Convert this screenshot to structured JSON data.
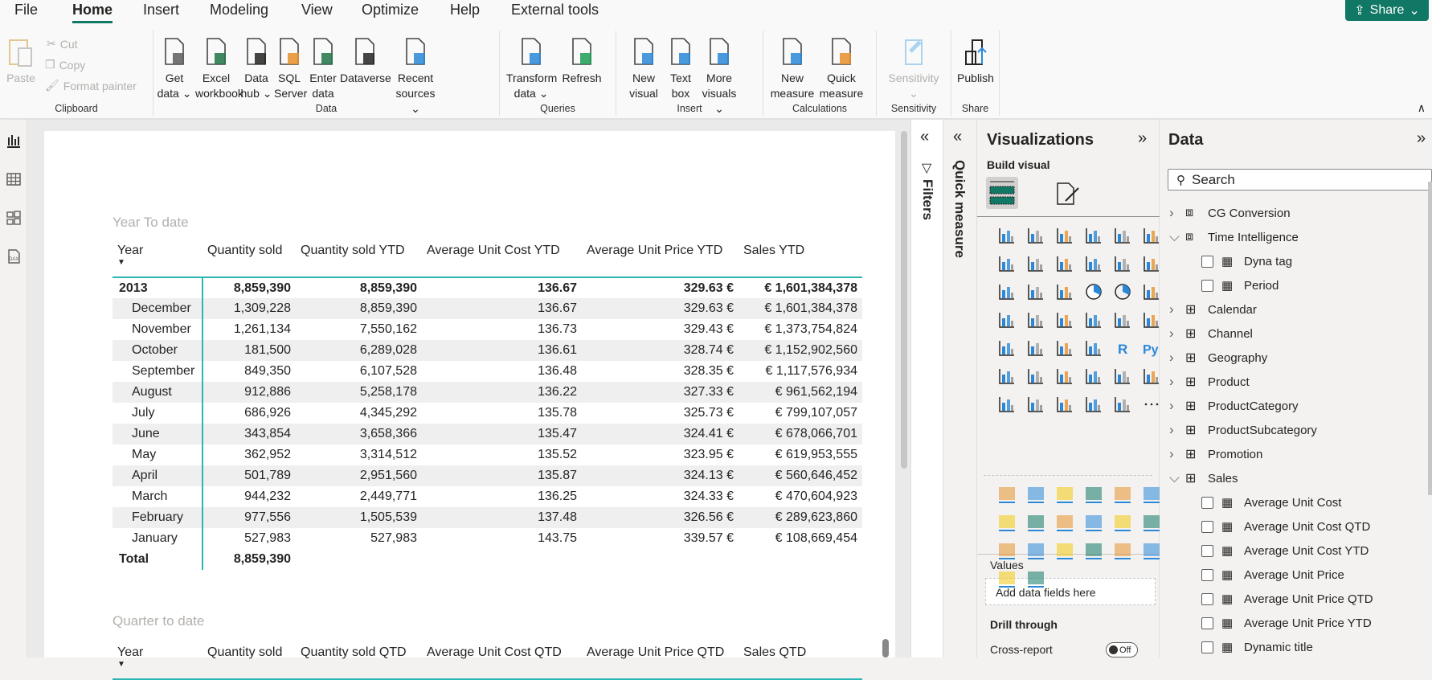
{
  "menu": {
    "tabs": [
      "File",
      "Home",
      "Insert",
      "Modeling",
      "View",
      "Optimize",
      "Help",
      "External tools"
    ],
    "active": "Home",
    "share_label": "Share"
  },
  "ribbon": {
    "clipboard": {
      "label": "Clipboard",
      "paste": "Paste",
      "cut": "Cut",
      "copy": "Copy",
      "format_painter": "Format painter"
    },
    "data": {
      "label": "Data",
      "buttons": [
        {
          "l1": "Get",
          "l2": "data ⌄",
          "icon": "database-icon",
          "accent": "#605e5c"
        },
        {
          "l1": "Excel",
          "l2": "workbook",
          "icon": "excel-icon",
          "accent": "#217346"
        },
        {
          "l1": "Data",
          "l2": "hub ⌄",
          "icon": "data-hub-icon",
          "accent": "#252423"
        },
        {
          "l1": "SQL",
          "l2": "Server",
          "icon": "sql-server-icon",
          "accent": "#e8912d"
        },
        {
          "l1": "Enter",
          "l2": "data",
          "icon": "enter-data-icon",
          "accent": "#217346"
        },
        {
          "l1": "Dataverse",
          "l2": "",
          "icon": "dataverse-icon",
          "accent": "#252423"
        },
        {
          "l1": "Recent",
          "l2": "sources ⌄",
          "icon": "recent-sources-icon",
          "accent": "#2b88d8"
        }
      ]
    },
    "queries": {
      "label": "Queries",
      "buttons": [
        {
          "l1": "Transform",
          "l2": "data ⌄",
          "icon": "transform-data-icon",
          "accent": "#2b88d8"
        },
        {
          "l1": "Refresh",
          "l2": "",
          "icon": "refresh-icon",
          "accent": "#1f9d55"
        }
      ]
    },
    "insert": {
      "label": "Insert",
      "buttons": [
        {
          "l1": "New",
          "l2": "visual",
          "icon": "new-visual-icon",
          "accent": "#2b88d8"
        },
        {
          "l1": "Text",
          "l2": "box",
          "icon": "text-box-icon",
          "accent": "#2b88d8"
        },
        {
          "l1": "More",
          "l2": "visuals ⌄",
          "icon": "more-visuals-icon",
          "accent": "#2b88d8"
        }
      ]
    },
    "calculations": {
      "label": "Calculations",
      "buttons": [
        {
          "l1": "New",
          "l2": "measure",
          "icon": "new-measure-icon",
          "accent": "#2b88d8"
        },
        {
          "l1": "Quick",
          "l2": "measure",
          "icon": "quick-measure-icon",
          "accent": "#e8912d"
        }
      ]
    },
    "sensitivity": {
      "label": "Sensitivity",
      "button": "Sensitivity",
      "chev": "⌄"
    },
    "share": {
      "label": "Share",
      "button": "Publish"
    }
  },
  "report": {
    "ytd": {
      "title": "Year To date",
      "columns": [
        "Year",
        "Quantity sold",
        "Quantity sold YTD",
        "Average Unit Cost YTD",
        "Average Unit Price YTD",
        "Sales YTD"
      ],
      "rows": [
        {
          "type": "year",
          "cells": [
            "2013",
            "8,859,390",
            "8,859,390",
            "136.67",
            "329.63 €",
            "€ 1,601,384,378"
          ]
        },
        {
          "type": "month",
          "cells": [
            "December",
            "1,309,228",
            "8,859,390",
            "136.67",
            "329.63 €",
            "€ 1,601,384,378"
          ]
        },
        {
          "type": "month",
          "cells": [
            "November",
            "1,261,134",
            "7,550,162",
            "136.73",
            "329.43 €",
            "€ 1,373,754,824"
          ]
        },
        {
          "type": "month",
          "cells": [
            "October",
            "181,500",
            "6,289,028",
            "136.61",
            "328.74 €",
            "€ 1,152,902,560"
          ]
        },
        {
          "type": "month",
          "cells": [
            "September",
            "849,350",
            "6,107,528",
            "136.48",
            "328.35 €",
            "€ 1,117,576,934"
          ]
        },
        {
          "type": "month",
          "cells": [
            "August",
            "912,886",
            "5,258,178",
            "136.22",
            "327.33 €",
            "€ 961,562,194"
          ]
        },
        {
          "type": "month",
          "cells": [
            "July",
            "686,926",
            "4,345,292",
            "135.78",
            "325.73 €",
            "€ 799,107,057"
          ]
        },
        {
          "type": "month",
          "cells": [
            "June",
            "343,854",
            "3,658,366",
            "135.47",
            "324.41 €",
            "€ 678,066,701"
          ]
        },
        {
          "type": "month",
          "cells": [
            "May",
            "362,952",
            "3,314,512",
            "135.52",
            "323.95 €",
            "€ 619,953,555"
          ]
        },
        {
          "type": "month",
          "cells": [
            "April",
            "501,789",
            "2,951,560",
            "135.87",
            "324.13 €",
            "€ 560,646,452"
          ]
        },
        {
          "type": "month",
          "cells": [
            "March",
            "944,232",
            "2,449,771",
            "136.25",
            "324.33 €",
            "€ 470,604,923"
          ]
        },
        {
          "type": "month",
          "cells": [
            "February",
            "977,556",
            "1,505,539",
            "137.48",
            "326.56 €",
            "€ 289,623,860"
          ]
        },
        {
          "type": "month",
          "cells": [
            "January",
            "527,983",
            "527,983",
            "143.75",
            "339.57 €",
            "€ 108,669,454"
          ]
        },
        {
          "type": "total",
          "cells": [
            "Total",
            "8,859,390",
            "",
            "",
            "",
            ""
          ]
        }
      ]
    },
    "qtd": {
      "title": "Quarter to date",
      "columns": [
        "Year",
        "Quantity sold",
        "Quantity sold QTD",
        "Average Unit Cost QTD",
        "Average Unit Price QTD",
        "Sales QTD"
      ]
    }
  },
  "filters": {
    "label": "Filters"
  },
  "quick_measure": {
    "label": "Quick measure"
  },
  "visualizations": {
    "title": "Visualizations",
    "build_visual": "Build visual",
    "icons": [
      "stacked-bar-icon",
      "stacked-column-icon",
      "clustered-bar-icon",
      "clustered-column-icon",
      "100-stacked-bar-icon",
      "100-stacked-column-icon",
      "line-chart-icon",
      "area-chart-icon",
      "stacked-area-icon",
      "line-column-icon",
      "line-clustered-column-icon",
      "ribbon-chart-icon",
      "waterfall-icon",
      "funnel-icon",
      "scatter-icon",
      "pie-icon",
      "donut-icon",
      "treemap-icon",
      "map-icon",
      "filled-map-icon",
      "azure-map-icon",
      "gauge-icon",
      "card-icon",
      "multi-row-card-icon",
      "kpi-icon",
      "slicer-icon",
      "table-icon",
      "matrix-icon",
      "r-visual-icon",
      "python-visual-icon",
      "key-influencers-icon",
      "decomposition-tree-icon",
      "qna-icon",
      "smart-narrative-icon",
      "metrics-icon",
      "paginated-report-icon",
      "new-card-icon",
      "new-slicer-icon",
      "arcgis-icon",
      "power-apps-icon",
      "power-automate-icon",
      "more-options-icon"
    ],
    "custom_icons": [
      "custom-gauge-icon",
      "custom-sunburst-icon",
      "custom-bullet-icon",
      "custom-funnel-icon",
      "custom-bar-icon",
      "custom-sparkline-icon",
      "custom-heatmap-icon",
      "custom-cards-icon",
      "custom-small-multiples-icon",
      "custom-gantt-icon",
      "custom-histogram-icon",
      "custom-mekko-icon",
      "custom-bubble-icon",
      "custom-sankey-icon",
      "custom-radar-icon",
      "custom-packed-bubble-icon",
      "custom-timeline-icon",
      "custom-variance-icon",
      "custom-word-cloud-icon",
      "custom-table-icon"
    ],
    "values_label": "Values",
    "values_placeholder": "Add data fields here",
    "drill_through": "Drill through",
    "cross_report": "Cross-report",
    "cross_report_state": "Off"
  },
  "data_pane": {
    "title": "Data",
    "search_placeholder": "Search",
    "items": [
      {
        "label": "CG Conversion",
        "kind": "calc-group",
        "level": 0,
        "expanded": false
      },
      {
        "label": "Time Intelligence",
        "kind": "calc-group",
        "level": 0,
        "expanded": true
      },
      {
        "label": "Dyna tag",
        "kind": "measure",
        "level": 1
      },
      {
        "label": "Period",
        "kind": "calc-column",
        "level": 1
      },
      {
        "label": "Calendar",
        "kind": "table",
        "level": 0,
        "expanded": false
      },
      {
        "label": "Channel",
        "kind": "table",
        "level": 0,
        "expanded": false
      },
      {
        "label": "Geography",
        "kind": "table",
        "level": 0,
        "expanded": false
      },
      {
        "label": "Product",
        "kind": "table",
        "level": 0,
        "expanded": false
      },
      {
        "label": "ProductCategory",
        "kind": "table",
        "level": 0,
        "expanded": false
      },
      {
        "label": "ProductSubcategory",
        "kind": "table",
        "level": 0,
        "expanded": false
      },
      {
        "label": "Promotion",
        "kind": "table",
        "level": 0,
        "expanded": false
      },
      {
        "label": "Sales",
        "kind": "table",
        "level": 0,
        "expanded": true
      },
      {
        "label": "Average Unit Cost",
        "kind": "measure",
        "level": 1
      },
      {
        "label": "Average Unit Cost QTD",
        "kind": "measure",
        "level": 1
      },
      {
        "label": "Average Unit Cost YTD",
        "kind": "measure",
        "level": 1
      },
      {
        "label": "Average Unit Price",
        "kind": "measure",
        "level": 1
      },
      {
        "label": "Average Unit Price QTD",
        "kind": "measure",
        "level": 1
      },
      {
        "label": "Average Unit Price YTD",
        "kind": "measure",
        "level": 1
      },
      {
        "label": "Dynamic title",
        "kind": "measure",
        "level": 1
      }
    ]
  },
  "colors": {
    "accent": "#117865",
    "table_rule": "#2bb5b3",
    "viz_blue": "#2b88d8"
  }
}
